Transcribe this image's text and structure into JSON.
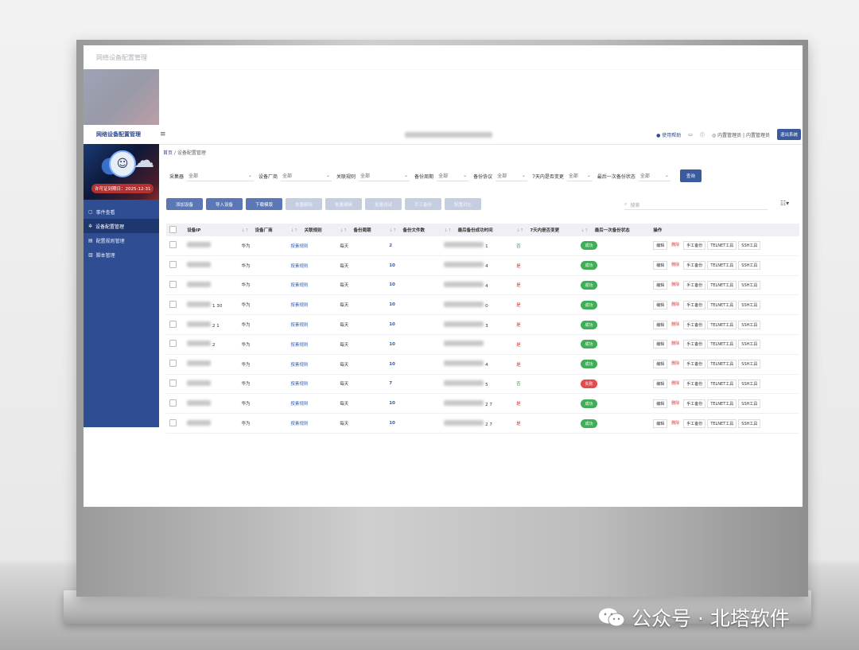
{
  "app": {
    "logo": "网络设备配置管理",
    "help_label": "使用帮助",
    "user_label": "内置管理员 | 内置管理员",
    "quit_label": "退出系统",
    "license_text": "许可证到期日：2025-12-31"
  },
  "sidebar": {
    "items": [
      {
        "label": "事件查看",
        "icon": "doc-icon"
      },
      {
        "label": "设备配置管理",
        "icon": "cog-icon"
      },
      {
        "label": "配置规则管理",
        "icon": "list-icon"
      },
      {
        "label": "脚本管理",
        "icon": "script-icon"
      }
    ],
    "active_index": 1
  },
  "breadcrumb": {
    "home": "首页",
    "current": "设备配置管理"
  },
  "filters": [
    {
      "label": "采集器",
      "value": "全部"
    },
    {
      "label": "设备厂商",
      "value": "全部"
    },
    {
      "label": "关联规则",
      "value": "全部"
    },
    {
      "label": "备份周期",
      "value": "全部"
    },
    {
      "label": "备份协议",
      "value": "全部"
    },
    {
      "label": "7天内是否变更",
      "value": "全部"
    },
    {
      "label": "最后一次备份状态",
      "value": "全部"
    }
  ],
  "query_label": "查询",
  "toolbar": [
    {
      "label": "添加设备",
      "enabled": true
    },
    {
      "label": "导入设备",
      "enabled": true
    },
    {
      "label": "下载模版",
      "enabled": true
    },
    {
      "label": "批量删除",
      "enabled": false
    },
    {
      "label": "批量编辑",
      "enabled": false
    },
    {
      "label": "批量测试",
      "enabled": false
    },
    {
      "label": "手工备份",
      "enabled": false
    },
    {
      "label": "配置对比",
      "enabled": false
    }
  ],
  "search_placeholder": "搜索",
  "table": {
    "headers": [
      "设备IP",
      "设备厂商",
      "关联规则",
      "备份周期",
      "备份文件数",
      "最后备份成功时间",
      "7天内是否变更",
      "最后一次备份状态",
      "操作"
    ],
    "rows": [
      {
        "ip_partial": "",
        "vendor": "华为",
        "rule": "按素规则",
        "cycle": "每天",
        "files": "2",
        "time_partial": "1",
        "changed": "否",
        "status": "成功"
      },
      {
        "ip_partial": "",
        "vendor": "华为",
        "rule": "按素规则",
        "cycle": "每天",
        "files": "10",
        "time_partial": "4",
        "changed": "是",
        "status": "成功"
      },
      {
        "ip_partial": "",
        "vendor": "华为",
        "rule": "按素规则",
        "cycle": "每天",
        "files": "10",
        "time_partial": "4",
        "changed": "是",
        "status": "成功"
      },
      {
        "ip_partial": "1 30",
        "vendor": "华为",
        "rule": "按素规则",
        "cycle": "每天",
        "files": "10",
        "time_partial": "0",
        "changed": "是",
        "status": "成功"
      },
      {
        "ip_partial": "2 1",
        "vendor": "华为",
        "rule": "按素规则",
        "cycle": "每天",
        "files": "10",
        "time_partial": "3",
        "changed": "是",
        "status": "成功"
      },
      {
        "ip_partial": "2",
        "vendor": "华为",
        "rule": "按素规则",
        "cycle": "每天",
        "files": "10",
        "time_partial": "",
        "changed": "是",
        "status": "成功"
      },
      {
        "ip_partial": "",
        "vendor": "华为",
        "rule": "按素规则",
        "cycle": "每天",
        "files": "10",
        "time_partial": "4",
        "changed": "是",
        "status": "成功"
      },
      {
        "ip_partial": "",
        "vendor": "华为",
        "rule": "按素规则",
        "cycle": "每天",
        "files": "7",
        "time_partial": "5",
        "changed": "否",
        "status": "失败"
      },
      {
        "ip_partial": "",
        "vendor": "华为",
        "rule": "按素规则",
        "cycle": "每天",
        "files": "10",
        "time_partial": "2 7",
        "changed": "是",
        "status": "成功"
      },
      {
        "ip_partial": "",
        "vendor": "华为",
        "rule": "按素规则",
        "cycle": "每天",
        "files": "10",
        "time_partial": "2 7",
        "changed": "是",
        "status": "成功"
      }
    ],
    "ops": [
      "编辑",
      "删除",
      "手工备份",
      "TELNET工具",
      "SSH工具"
    ]
  },
  "colors": {
    "primary": "#3c5a9e",
    "sidebar": "#2e4d92",
    "success": "#3fae57",
    "danger": "#e24c4c"
  },
  "watermark": "公众号 · 北塔软件"
}
